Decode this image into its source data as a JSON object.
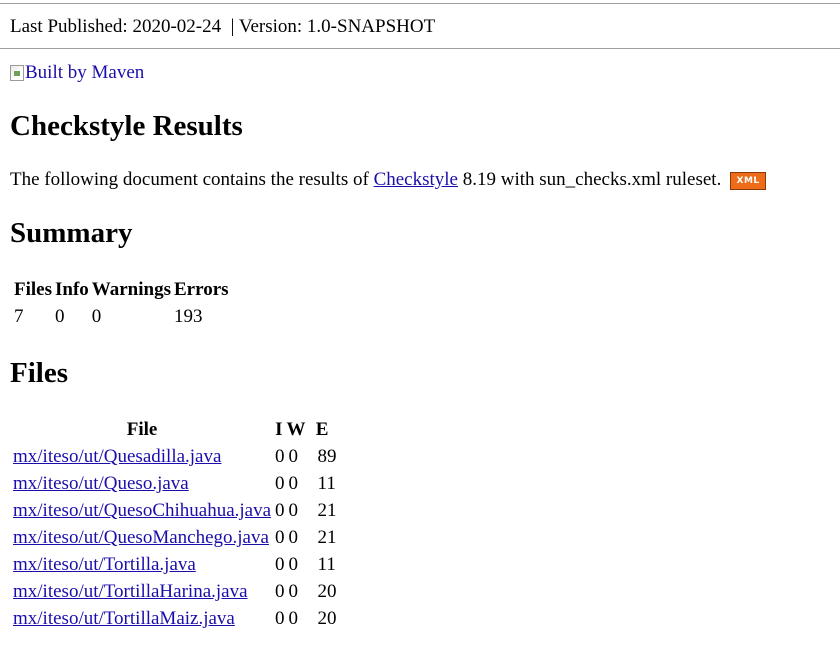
{
  "header": {
    "published": "Last Published: 2020-02-24",
    "separator": "|",
    "version": "Version: 1.0-SNAPSHOT"
  },
  "logo": {
    "alt": "Built by Maven"
  },
  "title": "Checkstyle Results",
  "intro": {
    "prefix": "The following document contains the results of",
    "link": "Checkstyle",
    "suffix": "8.19 with sun_checks.xml ruleset.",
    "xml_badge": "XML"
  },
  "summary": {
    "heading": "Summary",
    "columns": [
      "Files",
      "Info",
      "Warnings",
      "Errors"
    ],
    "values": [
      "7",
      "0",
      "0",
      "193"
    ]
  },
  "files": {
    "heading": "Files",
    "columns": [
      "File",
      "I",
      "W",
      "E"
    ],
    "rows": [
      {
        "file": "mx/iteso/ut/Quesadilla.java",
        "i": "0",
        "w": "0",
        "e": "89"
      },
      {
        "file": "mx/iteso/ut/Queso.java",
        "i": "0",
        "w": "0",
        "e": "11"
      },
      {
        "file": "mx/iteso/ut/QuesoChihuahua.java",
        "i": "0",
        "w": "0",
        "e": "21"
      },
      {
        "file": "mx/iteso/ut/QuesoManchego.java",
        "i": "0",
        "w": "0",
        "e": "21"
      },
      {
        "file": "mx/iteso/ut/Tortilla.java",
        "i": "0",
        "w": "0",
        "e": "11"
      },
      {
        "file": "mx/iteso/ut/TortillaHarina.java",
        "i": "0",
        "w": "0",
        "e": "20"
      },
      {
        "file": "mx/iteso/ut/TortillaMaiz.java",
        "i": "0",
        "w": "0",
        "e": "20"
      }
    ]
  },
  "colors": {
    "link": "#1a0dab",
    "rule": "#a0a0a0",
    "xml_badge": "#ee6b1a"
  }
}
